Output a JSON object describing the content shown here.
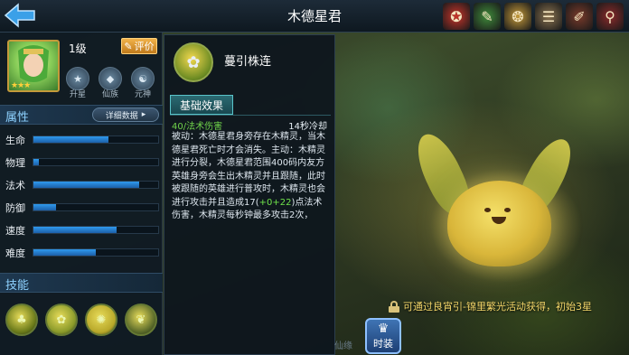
{
  "header": {
    "title": "木德星君",
    "back_icon": "back-arrow-icon",
    "top_icons": [
      {
        "name": "treasure-icon",
        "glyph": "✪",
        "color": "#c9342a"
      },
      {
        "name": "scroll-icon",
        "glyph": "✎",
        "color": "#3f8a3a"
      },
      {
        "name": "coin-icon",
        "glyph": "❂",
        "color": "#c59a3a"
      },
      {
        "name": "document-icon",
        "glyph": "☰",
        "color": "#8a7350"
      },
      {
        "name": "quill-icon",
        "glyph": "✐",
        "color": "#7a3a2a"
      },
      {
        "name": "search-book-icon",
        "glyph": "⚲",
        "color": "#8a2a2a"
      }
    ]
  },
  "hero": {
    "level": "1级",
    "rate_label": "评价",
    "stars": "★★★",
    "badges": [
      {
        "label": "升星",
        "glyph": "★"
      },
      {
        "label": "仙族",
        "glyph": "◆"
      },
      {
        "label": "元神",
        "glyph": "☯"
      }
    ]
  },
  "attributes": {
    "title": "属性",
    "detail_label": "详细数据",
    "stats": [
      {
        "label": "生命",
        "value": 0.6
      },
      {
        "label": "物理",
        "value": 0.04
      },
      {
        "label": "法术",
        "value": 0.85
      },
      {
        "label": "防御",
        "value": 0.18
      },
      {
        "label": "速度",
        "value": 0.67
      },
      {
        "label": "难度",
        "value": 0.5
      }
    ]
  },
  "skills": {
    "title": "技能",
    "icons": [
      {
        "name": "skill-1-icon",
        "glyph": "♣",
        "color": "#6a7a1a"
      },
      {
        "name": "skill-2-icon",
        "glyph": "✿",
        "color": "#8a9a2a"
      },
      {
        "name": "skill-3-icon",
        "glyph": "✺",
        "color": "#b8a82a"
      },
      {
        "name": "skill-4-icon",
        "glyph": "❦",
        "color": "#5a6a2a"
      }
    ]
  },
  "skill_detail": {
    "name": "蔓引株连",
    "tab_label": "基础效果",
    "damage_type": "40/法术伤害",
    "cooldown": "14秒冷却",
    "desc_before": "被动：木德星君身旁存在木精灵，当木德星君死亡时才会消失。主动：木精灵进行分裂，木德星君范围400码内友方英雄身旁会生出木精灵并且跟随，此时被跟随的英雄进行普攻时，木精灵也会进行攻击并且造成17(",
    "desc_highlight": "+0+22",
    "desc_after": ")点法术伤害，木精灵每秒钟最多攻击2次，"
  },
  "footer": {
    "obtain_hint": "可通过良宵引-锦里繁光活动获得，初始3星",
    "tab_ghost": "仙缘",
    "tab_fashion": "时装"
  },
  "colors": {
    "accent_blue": "#2f9aee",
    "section_title": "#8ed2ff",
    "highlight_green": "#6fe24a",
    "hint_gold": "#f5d86a"
  }
}
